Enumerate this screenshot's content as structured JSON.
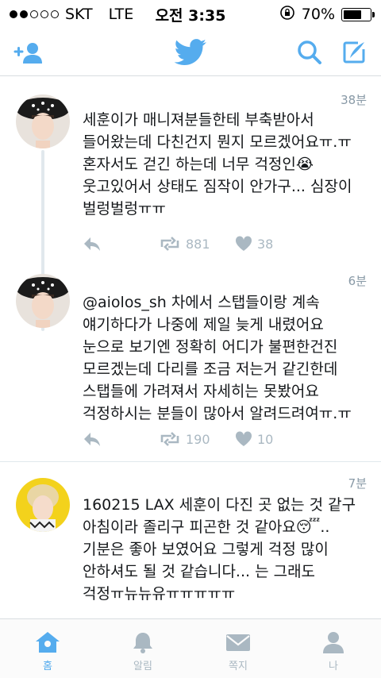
{
  "status_bar": {
    "carrier": "SKT",
    "network": "LTE",
    "time": "오전 3:35",
    "battery_percent": "70%",
    "battery_level": 0.7,
    "signal_bars_filled": 2,
    "signal_bars_total": 5
  },
  "nav": {
    "icons": [
      "add-user-icon",
      "twitter-bird-icon",
      "search-icon",
      "compose-icon"
    ],
    "accent_color": "#55acee"
  },
  "tweets": [
    {
      "time": "38분",
      "text": "세훈이가 매니져분들한테 부축받아서 들어왔는데 다친건지 뭔지 모르겠어요ㅠ.ㅠ 혼자서도 걷긴 하는데 너무 걱정인😭 웃고있어서 상태도 짐작이 안가구... 심장이 벌렁벌렁ㅠㅠ",
      "retweets": "881",
      "likes": "38"
    },
    {
      "time": "6분",
      "text": "@aiolos_sh 차에서 스탭들이랑 계속 얘기하다가 나중에 제일 늦게 내렸어요 눈으로 보기엔 정확히 어디가 불편한건진 모르겠는데 다리를 조금 저는거 같긴한데 스탭들에 가려져서 자세히는 못봤어요 걱정하시는 분들이 많아서 알려드려여ㅠ.ㅠ",
      "retweets": "190",
      "likes": "10"
    },
    {
      "time": "7분",
      "text": "160215 LAX 세훈이 다진 곳 없는 것 같구 아침이라 졸리구 피곤한 것 같아요😴.. 기분은 좋아 보였어요 그렇게 걱정 많이 안하셔도 될 것 같습니다... 는 그래도 걱정ㅠ뉴뉴유ㅠㅠㅠㅠㅠ"
    }
  ],
  "tab_bar": {
    "tabs": [
      {
        "label": "홈",
        "icon": "home-icon",
        "active": true
      },
      {
        "label": "알림",
        "icon": "bell-icon",
        "active": false
      },
      {
        "label": "쪽지",
        "icon": "envelope-icon",
        "active": false
      },
      {
        "label": "나",
        "icon": "profile-icon",
        "active": false
      }
    ]
  },
  "colors": {
    "twitter_blue": "#55acee",
    "muted_gray": "#aab8c2",
    "text": "#14171a"
  }
}
